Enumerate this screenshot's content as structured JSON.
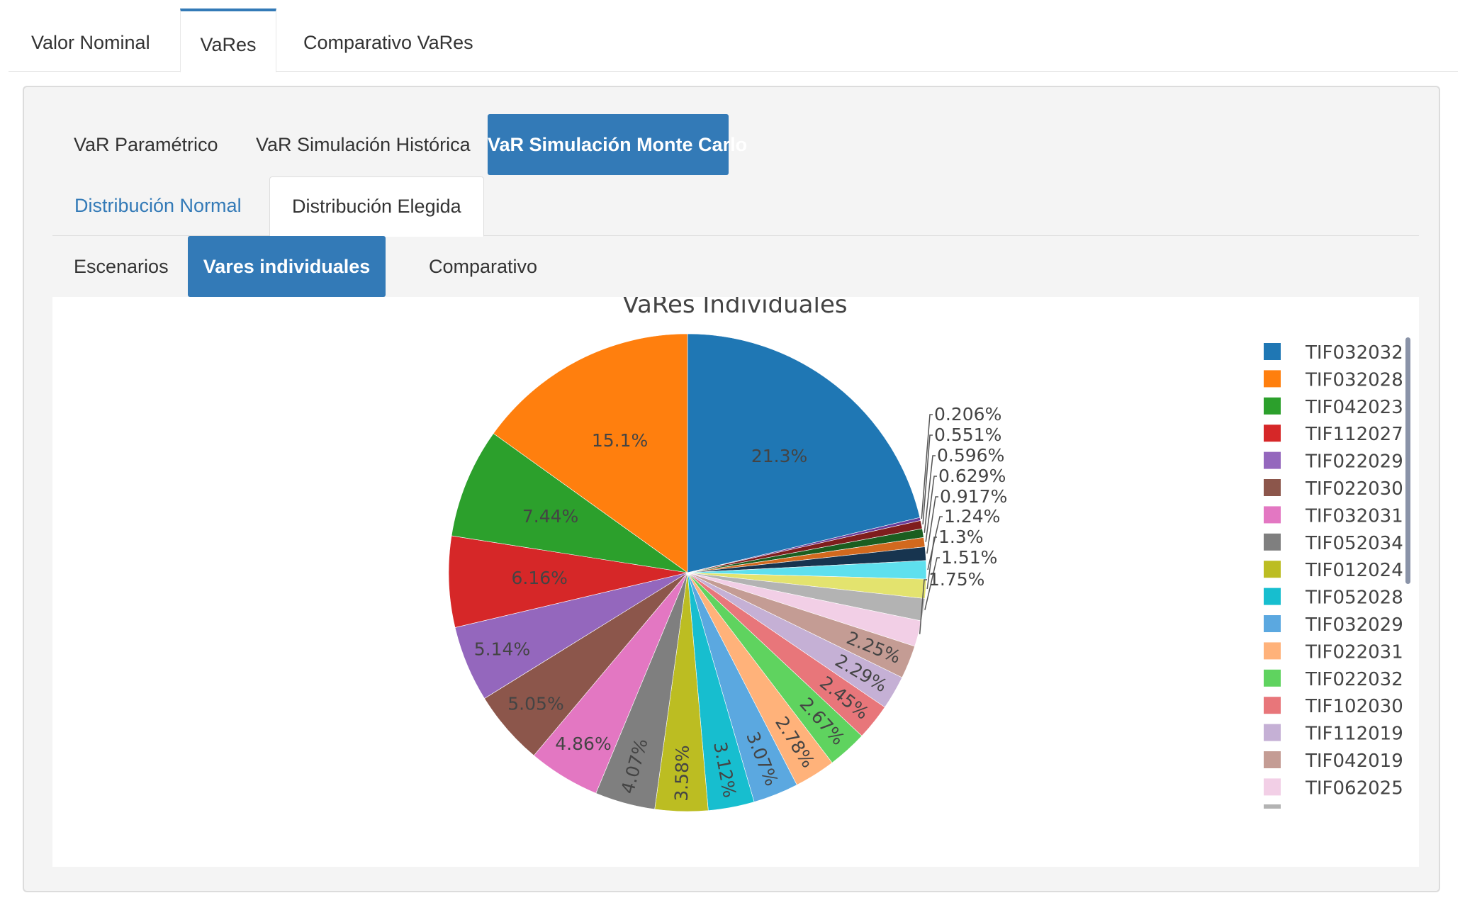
{
  "top_tabs": [
    "Valor Nominal",
    "VaRes",
    "Comparativo VaRes"
  ],
  "method_tabs": [
    "VaR Paramétrico",
    "VaR Simulación Histórica",
    "VaR Simulación Monte Carlo"
  ],
  "dist_tabs": [
    "Distribución Normal",
    "Distribución Elegida"
  ],
  "sub_tabs": [
    "Escenarios",
    "Vares individuales",
    "Comparativo"
  ],
  "chart_data": {
    "type": "pie",
    "title": "VaRes Individuales",
    "direction": "clockwise",
    "legend_position": "right",
    "slices": [
      {
        "label": "TIF032032",
        "value": 21.3,
        "text": "21.3%",
        "color": "#1f77b4"
      },
      {
        "label": "",
        "value": 0.206,
        "text": "0.206%",
        "color": "#6a3d9a"
      },
      {
        "label": "",
        "value": 0.551,
        "text": "0.551%",
        "color": "#7f1d1d"
      },
      {
        "label": "",
        "value": 0.596,
        "text": "0.596%",
        "color": "#1b5e20"
      },
      {
        "label": "",
        "value": 0.629,
        "text": "0.629%",
        "color": "#d2691e"
      },
      {
        "label": "",
        "value": 0.917,
        "text": "0.917%",
        "color": "#17344f"
      },
      {
        "label": "",
        "value": 1.24,
        "text": "1.24%",
        "color": "#5ee0ee"
      },
      {
        "label": "",
        "value": 1.3,
        "text": "1.3%",
        "color": "#e3e36e"
      },
      {
        "label": "",
        "value": 1.51,
        "text": "1.51%",
        "color": "#b3b3b3"
      },
      {
        "label": "TIF062025",
        "value": 1.75,
        "text": "1.75%",
        "color": "#f2cfe6"
      },
      {
        "label": "TIF042019",
        "value": 2.25,
        "text": "2.25%",
        "color": "#c49c94"
      },
      {
        "label": "TIF112019",
        "value": 2.29,
        "text": "2.29%",
        "color": "#c5b0d5"
      },
      {
        "label": "TIF102030",
        "value": 2.45,
        "text": "2.45%",
        "color": "#e8767a"
      },
      {
        "label": "TIF022032",
        "value": 2.67,
        "text": "2.67%",
        "color": "#5fd35f"
      },
      {
        "label": "TIF022031",
        "value": 2.78,
        "text": "2.78%",
        "color": "#ffb27a"
      },
      {
        "label": "TIF032029",
        "value": 3.07,
        "text": "3.07%",
        "color": "#5ba8e0"
      },
      {
        "label": "TIF052028",
        "value": 3.12,
        "text": "3.12%",
        "color": "#17becf"
      },
      {
        "label": "TIF012024",
        "value": 3.58,
        "text": "3.58%",
        "color": "#bcbd22"
      },
      {
        "label": "TIF052034",
        "value": 4.07,
        "text": "4.07%",
        "color": "#7f7f7f"
      },
      {
        "label": "TIF032031",
        "value": 4.86,
        "text": "4.86%",
        "color": "#e377c2"
      },
      {
        "label": "TIF022030",
        "value": 5.05,
        "text": "5.05%",
        "color": "#8c564b"
      },
      {
        "label": "TIF022029",
        "value": 5.14,
        "text": "5.14%",
        "color": "#9467bd"
      },
      {
        "label": "TIF112027",
        "value": 6.16,
        "text": "6.16%",
        "color": "#d62728"
      },
      {
        "label": "TIF042023",
        "value": 7.44,
        "text": "7.44%",
        "color": "#2ca02c"
      },
      {
        "label": "TIF032028",
        "value": 15.1,
        "text": "15.1%",
        "color": "#ff7f0e"
      }
    ],
    "legend": [
      {
        "label": "TIF032032",
        "color": "#1f77b4"
      },
      {
        "label": "TIF032028",
        "color": "#ff7f0e"
      },
      {
        "label": "TIF042023",
        "color": "#2ca02c"
      },
      {
        "label": "TIF112027",
        "color": "#d62728"
      },
      {
        "label": "TIF022029",
        "color": "#9467bd"
      },
      {
        "label": "TIF022030",
        "color": "#8c564b"
      },
      {
        "label": "TIF032031",
        "color": "#e377c2"
      },
      {
        "label": "TIF052034",
        "color": "#7f7f7f"
      },
      {
        "label": "TIF012024",
        "color": "#bcbd22"
      },
      {
        "label": "TIF052028",
        "color": "#17becf"
      },
      {
        "label": "TIF032029",
        "color": "#5ba8e0"
      },
      {
        "label": "TIF022031",
        "color": "#ffb27a"
      },
      {
        "label": "TIF022032",
        "color": "#5fd35f"
      },
      {
        "label": "TIF102030",
        "color": "#e8767a"
      },
      {
        "label": "TIF112019",
        "color": "#c5b0d5"
      },
      {
        "label": "TIF042019",
        "color": "#c49c94"
      },
      {
        "label": "TIF062025",
        "color": "#f2cfe6"
      }
    ]
  },
  "colors": {
    "accent": "#337ab7",
    "link": "#337ab7",
    "panel_bg": "#f4f4f4"
  }
}
